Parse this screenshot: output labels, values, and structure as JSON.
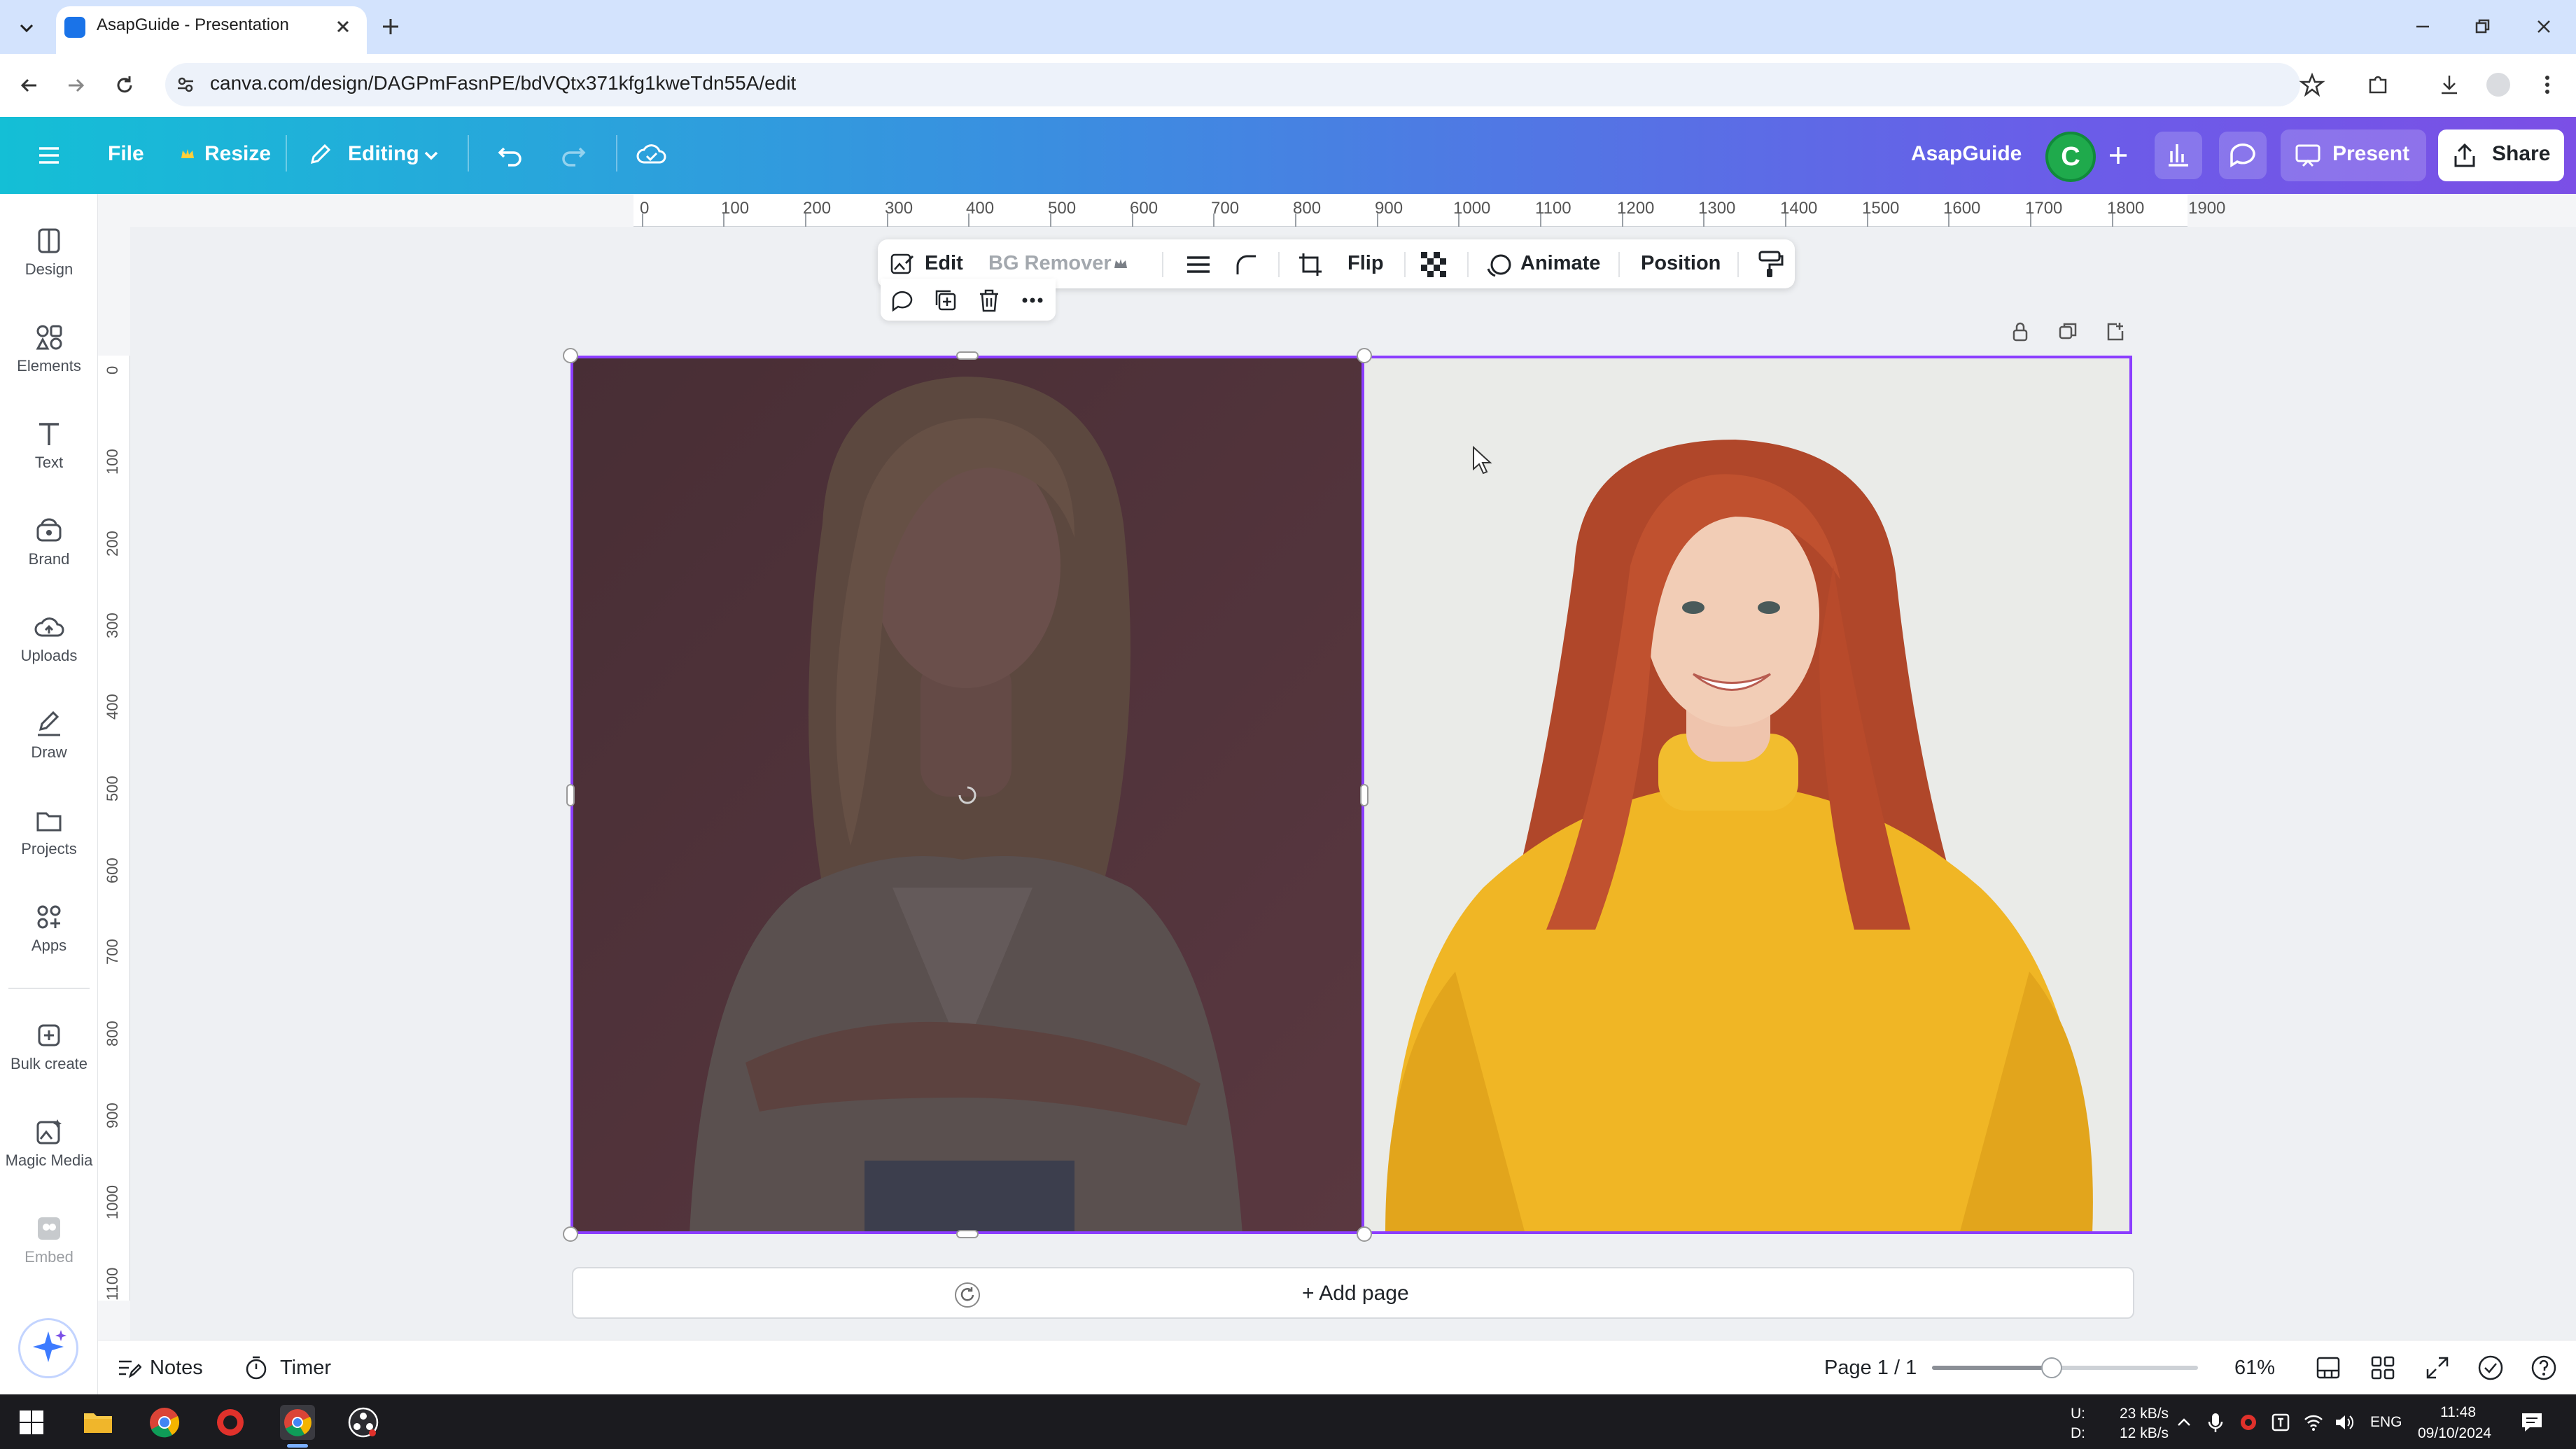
{
  "browser": {
    "tab_title": "AsapGuide - Presentation",
    "url": "canva.com/design/DAGPmFasnPE/bdVQtx371kfg1kweTdn55A/edit"
  },
  "header": {
    "file": "File",
    "resize": "Resize",
    "editing": "Editing",
    "design_name": "AsapGuide",
    "avatar_letter": "C",
    "present": "Present",
    "share": "Share"
  },
  "sidebar": {
    "items": [
      {
        "label": "Design",
        "icon": "design-icon"
      },
      {
        "label": "Elements",
        "icon": "elements-icon"
      },
      {
        "label": "Text",
        "icon": "text-icon"
      },
      {
        "label": "Brand",
        "icon": "brand-icon"
      },
      {
        "label": "Uploads",
        "icon": "uploads-icon"
      },
      {
        "label": "Draw",
        "icon": "draw-icon"
      },
      {
        "label": "Projects",
        "icon": "projects-icon"
      },
      {
        "label": "Apps",
        "icon": "apps-icon"
      },
      {
        "label": "Bulk create",
        "icon": "bulk-create-icon"
      },
      {
        "label": "Magic Media",
        "icon": "magic-media-icon"
      },
      {
        "label": "Embed",
        "icon": "embed-icon"
      }
    ]
  },
  "ruler": {
    "top": [
      "0",
      "100",
      "200",
      "300",
      "400",
      "500",
      "600",
      "700",
      "800",
      "900",
      "1000",
      "1100",
      "1200",
      "1300",
      "1400",
      "1500",
      "1600",
      "1700",
      "1800",
      "1900"
    ],
    "left": [
      "0",
      "100",
      "200",
      "300",
      "400",
      "500",
      "600",
      "700",
      "800",
      "900",
      "1000",
      "1100"
    ]
  },
  "toolbar": {
    "edit": "Edit",
    "bg_remover": "BG Remover",
    "flip": "Flip",
    "animate": "Animate",
    "position": "Position"
  },
  "canvas": {
    "add_page": "+ Add page"
  },
  "footer": {
    "notes": "Notes",
    "timer": "Timer",
    "page_indicator": "Page 1 / 1",
    "zoom": "61%",
    "zoom_fraction": 0.45
  },
  "taskbar": {
    "net_up_label": "U:",
    "net_down_label": "D:",
    "net_up": "23 kB/s",
    "net_down": "12 kB/s",
    "lang": "ENG",
    "time": "11:48",
    "date": "09/10/2024"
  },
  "colors": {
    "accent": "#8b3dff",
    "header_start": "#14bfd6",
    "header_end": "#7b4fe6"
  }
}
